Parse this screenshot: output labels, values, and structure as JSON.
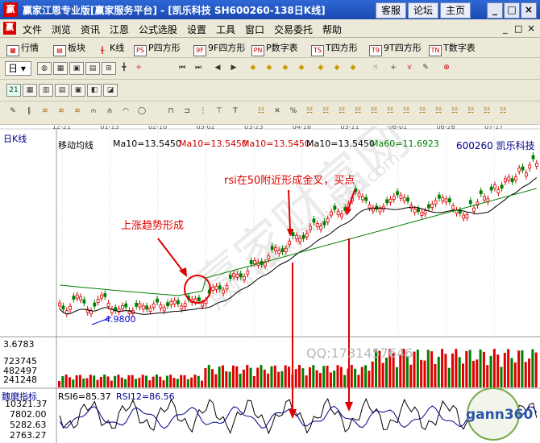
{
  "window": {
    "title": "赢家江恩专业版[赢家服务平台] - [凯乐科技  SH600260-138日K线]",
    "logo": "赢",
    "buttons": [
      "客服",
      "论坛",
      "主页"
    ],
    "controls": [
      "_",
      "□",
      "×"
    ]
  },
  "menu": {
    "logo": "赢",
    "items": [
      "文件",
      "浏览",
      "资讯",
      "江恩",
      "公式选股",
      "设置",
      "工具",
      "窗口",
      "交易委托",
      "帮助"
    ],
    "mdi_controls": [
      "_",
      "□",
      "×"
    ]
  },
  "toolbar1": {
    "items": [
      "行情",
      "板块",
      "K线",
      "P四方形",
      "9F四方形",
      "P数字表",
      "T四方形",
      "9T四方形",
      "T数字表"
    ],
    "icon_glyphs": [
      "PS",
      "9F",
      "PN",
      "TS",
      "T9",
      "TN"
    ]
  },
  "toolbar2": {
    "period": "日"
  },
  "chart": {
    "period_label": "日K线",
    "indicator_label": "移动均线",
    "ma_readouts": [
      "Ma10=13.5450",
      "Ma10=13.5450",
      "Ma10=13.5450",
      "Ma10=13.5450",
      "Ma60=11.6923"
    ],
    "stock": "600260 凯乐科技",
    "date_ticks": [
      "12-21",
      "01-13",
      "02-10",
      "03-02",
      "03-23",
      "04-18",
      "05-11",
      "06-01",
      "06-26",
      "07-17"
    ],
    "low_price_label": "4.9800",
    "annotation_uptrend": "上涨趋势形成",
    "annotation_rsi": "rsi在50附近形成金叉，买点",
    "watermark_qq": "QQ:1731457646",
    "watermark_site": "www.yingjia360.com",
    "watermark_brand": "赢家财富网",
    "volume_ticks": [
      "3.6783",
      "723745",
      "482497",
      "241248"
    ],
    "rsi_panel_label": "魏磨指标",
    "rsi_readouts": [
      "RSI6=85.37",
      "RSI12=86.56"
    ],
    "rsi_ticks": [
      "10321.37",
      "7802.00",
      "5282.63",
      "2763.27"
    ],
    "logo_text": "gann360",
    "colors": {
      "up": "#e00000",
      "down": "#008000",
      "ma10": "#000000",
      "ma60": "#008000",
      "annotation": "#e00000"
    }
  }
}
